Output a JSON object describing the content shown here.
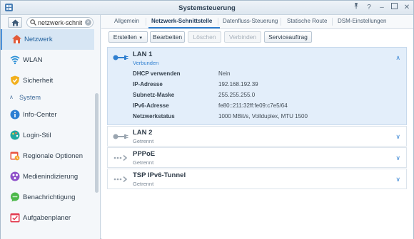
{
  "window": {
    "title": "Systemsteuerung",
    "controls": [
      "pin-icon",
      "help-icon",
      "minimize-icon",
      "maximize-icon",
      "close-icon"
    ]
  },
  "sidebar": {
    "search": {
      "value": "netzwerk-schnitts",
      "placeholder": ""
    },
    "items": [
      {
        "label": "Netzwerk",
        "icon": "house-network-icon",
        "active": true
      },
      {
        "label": "WLAN",
        "icon": "wifi-icon"
      },
      {
        "label": "Sicherheit",
        "icon": "shield-icon"
      }
    ],
    "section": {
      "label": "System",
      "expanded": true
    },
    "system_items": [
      {
        "label": "Info-Center",
        "icon": "info-icon"
      },
      {
        "label": "Login-Stil",
        "icon": "palette-icon"
      },
      {
        "label": "Regionale Optionen",
        "icon": "calendar-clock-icon"
      },
      {
        "label": "Medienindizierung",
        "icon": "media-icon"
      },
      {
        "label": "Benachrichtigung",
        "icon": "chat-icon"
      },
      {
        "label": "Aufgabenplaner",
        "icon": "checklist-icon"
      }
    ]
  },
  "tabs": [
    {
      "label": "Allgemein"
    },
    {
      "label": "Netzwerk-Schnittstelle",
      "active": true
    },
    {
      "label": "Datenfluss-Steuerung"
    },
    {
      "label": "Statische Route"
    },
    {
      "label": "DSM-Einstellungen"
    }
  ],
  "toolbar": {
    "create": "Erstellen",
    "edit": "Bearbeiten",
    "delete": "Löschen",
    "connect": "Verbinden",
    "service": "Serviceauftrag"
  },
  "interfaces": [
    {
      "name": "LAN 1",
      "status": "Verbunden",
      "expanded": true,
      "details": [
        {
          "key": "DHCP verwenden",
          "value": "Nein"
        },
        {
          "key": "IP-Adresse",
          "value": "192.168.192.39"
        },
        {
          "key": "Subnetz-Maske",
          "value": "255.255.255.0"
        },
        {
          "key": "IPv6-Adresse",
          "value": "fe80::211:32ff:fe09:c7e5/64"
        },
        {
          "key": "Netzwerkstatus",
          "value": "1000 MBit/s, Vollduplex, MTU 1500"
        }
      ]
    },
    {
      "name": "LAN 2",
      "status": "Getrennt"
    },
    {
      "name": "PPPoE",
      "status": "Getrennt"
    },
    {
      "name": "TSP IPv6-Tunnel",
      "status": "Getrennt"
    }
  ],
  "colors": {
    "accent": "#2f7fd0",
    "selected_bg": "#d7e6f4",
    "expanded_bg": "#e3eefa"
  }
}
